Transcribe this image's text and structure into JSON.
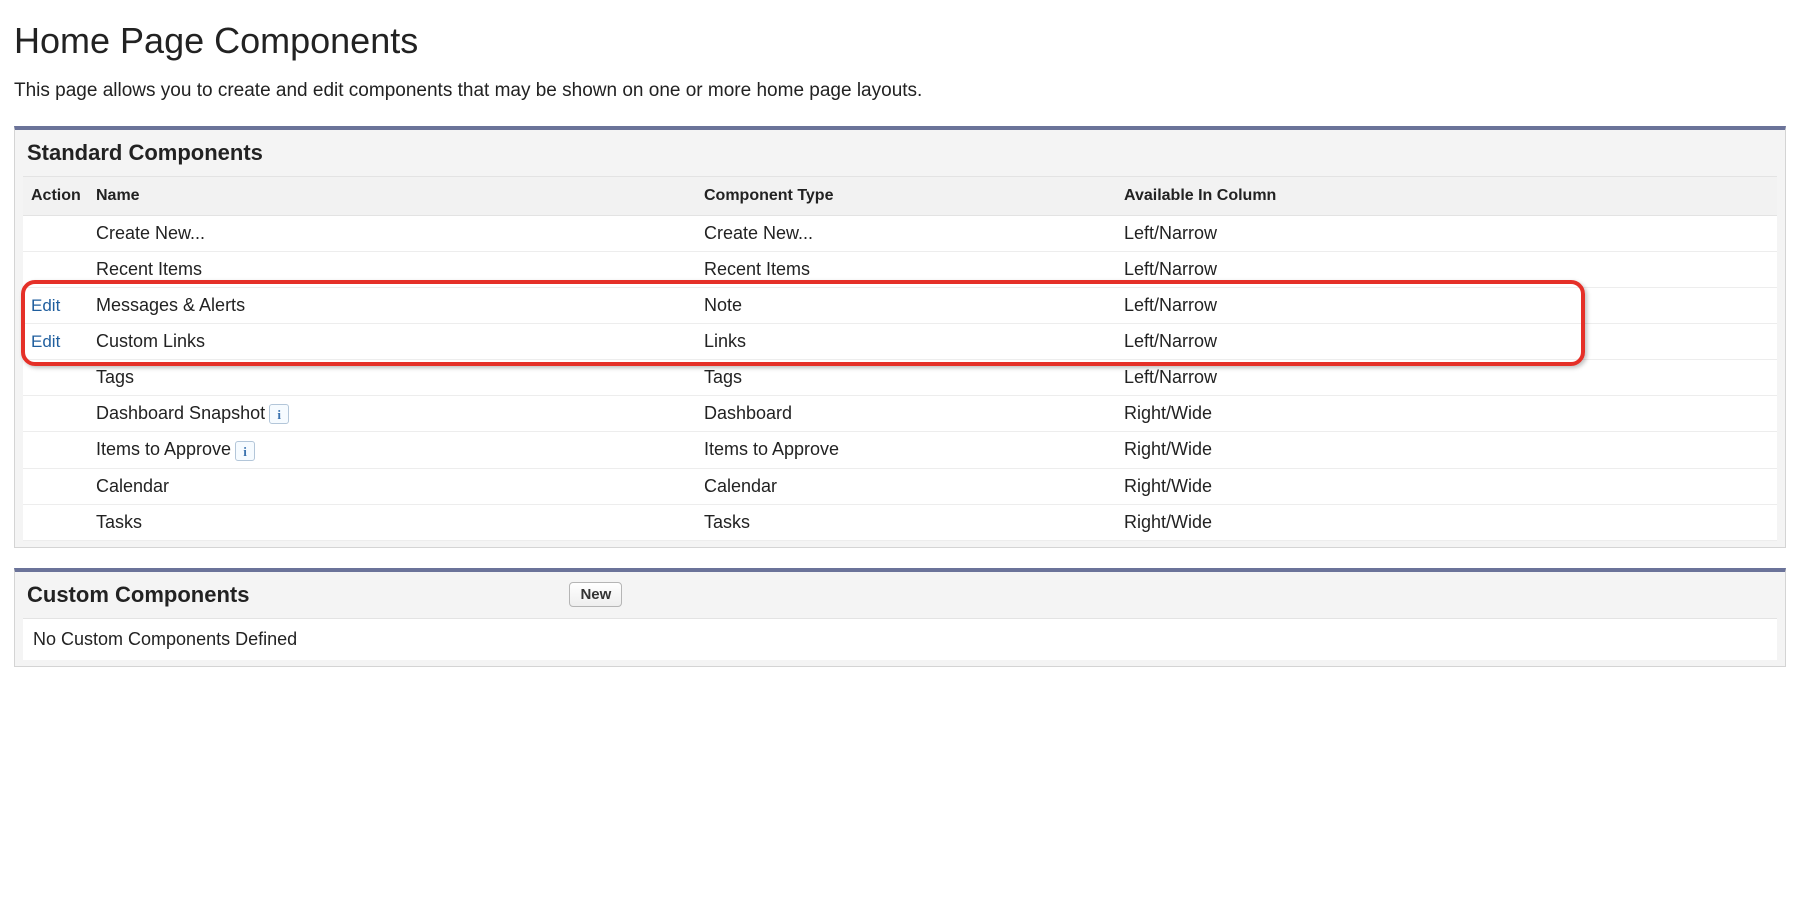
{
  "page": {
    "title": "Home Page Components",
    "description": "This page allows you to create and edit components that may be shown on one or more home page layouts."
  },
  "standard": {
    "title": "Standard Components",
    "columns": {
      "action": "Action",
      "name": "Name",
      "type": "Component Type",
      "available": "Available In Column"
    },
    "rows": [
      {
        "action": "",
        "name": "Create New...",
        "info": false,
        "type": "Create New...",
        "available": "Left/Narrow"
      },
      {
        "action": "",
        "name": "Recent Items",
        "info": false,
        "type": "Recent Items",
        "available": "Left/Narrow"
      },
      {
        "action": "Edit",
        "name": "Messages & Alerts",
        "info": false,
        "type": "Note",
        "available": "Left/Narrow"
      },
      {
        "action": "Edit",
        "name": "Custom Links",
        "info": false,
        "type": "Links",
        "available": "Left/Narrow"
      },
      {
        "action": "",
        "name": "Tags",
        "info": false,
        "type": "Tags",
        "available": "Left/Narrow"
      },
      {
        "action": "",
        "name": "Dashboard Snapshot",
        "info": true,
        "type": "Dashboard",
        "available": "Right/Wide"
      },
      {
        "action": "",
        "name": "Items to Approve",
        "info": true,
        "type": "Items to Approve",
        "available": "Right/Wide"
      },
      {
        "action": "",
        "name": "Calendar",
        "info": false,
        "type": "Calendar",
        "available": "Right/Wide"
      },
      {
        "action": "",
        "name": "Tasks",
        "info": false,
        "type": "Tasks",
        "available": "Right/Wide"
      }
    ]
  },
  "custom": {
    "title": "Custom Components",
    "new_label": "New",
    "empty": "No Custom Components Defined"
  }
}
